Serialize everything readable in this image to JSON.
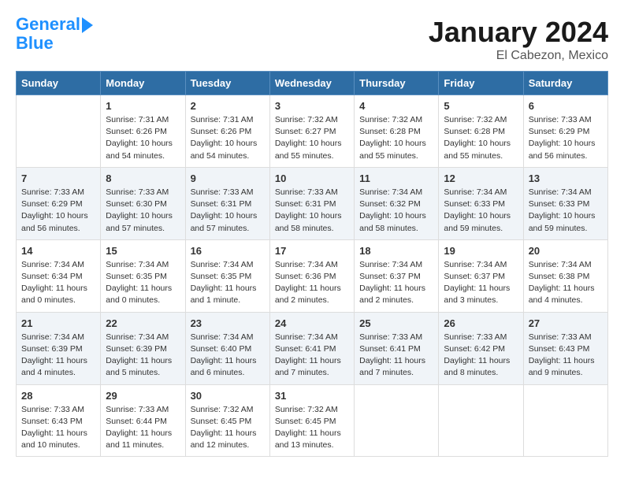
{
  "header": {
    "logo_line1": "General",
    "logo_line2": "Blue",
    "month": "January 2024",
    "location": "El Cabezon, Mexico"
  },
  "days_of_week": [
    "Sunday",
    "Monday",
    "Tuesday",
    "Wednesday",
    "Thursday",
    "Friday",
    "Saturday"
  ],
  "weeks": [
    [
      {
        "day": "",
        "info": ""
      },
      {
        "day": "1",
        "info": "Sunrise: 7:31 AM\nSunset: 6:26 PM\nDaylight: 10 hours\nand 54 minutes."
      },
      {
        "day": "2",
        "info": "Sunrise: 7:31 AM\nSunset: 6:26 PM\nDaylight: 10 hours\nand 54 minutes."
      },
      {
        "day": "3",
        "info": "Sunrise: 7:32 AM\nSunset: 6:27 PM\nDaylight: 10 hours\nand 55 minutes."
      },
      {
        "day": "4",
        "info": "Sunrise: 7:32 AM\nSunset: 6:28 PM\nDaylight: 10 hours\nand 55 minutes."
      },
      {
        "day": "5",
        "info": "Sunrise: 7:32 AM\nSunset: 6:28 PM\nDaylight: 10 hours\nand 55 minutes."
      },
      {
        "day": "6",
        "info": "Sunrise: 7:33 AM\nSunset: 6:29 PM\nDaylight: 10 hours\nand 56 minutes."
      }
    ],
    [
      {
        "day": "7",
        "info": "Sunrise: 7:33 AM\nSunset: 6:29 PM\nDaylight: 10 hours\nand 56 minutes."
      },
      {
        "day": "8",
        "info": "Sunrise: 7:33 AM\nSunset: 6:30 PM\nDaylight: 10 hours\nand 57 minutes."
      },
      {
        "day": "9",
        "info": "Sunrise: 7:33 AM\nSunset: 6:31 PM\nDaylight: 10 hours\nand 57 minutes."
      },
      {
        "day": "10",
        "info": "Sunrise: 7:33 AM\nSunset: 6:31 PM\nDaylight: 10 hours\nand 58 minutes."
      },
      {
        "day": "11",
        "info": "Sunrise: 7:34 AM\nSunset: 6:32 PM\nDaylight: 10 hours\nand 58 minutes."
      },
      {
        "day": "12",
        "info": "Sunrise: 7:34 AM\nSunset: 6:33 PM\nDaylight: 10 hours\nand 59 minutes."
      },
      {
        "day": "13",
        "info": "Sunrise: 7:34 AM\nSunset: 6:33 PM\nDaylight: 10 hours\nand 59 minutes."
      }
    ],
    [
      {
        "day": "14",
        "info": "Sunrise: 7:34 AM\nSunset: 6:34 PM\nDaylight: 11 hours\nand 0 minutes."
      },
      {
        "day": "15",
        "info": "Sunrise: 7:34 AM\nSunset: 6:35 PM\nDaylight: 11 hours\nand 0 minutes."
      },
      {
        "day": "16",
        "info": "Sunrise: 7:34 AM\nSunset: 6:35 PM\nDaylight: 11 hours\nand 1 minute."
      },
      {
        "day": "17",
        "info": "Sunrise: 7:34 AM\nSunset: 6:36 PM\nDaylight: 11 hours\nand 2 minutes."
      },
      {
        "day": "18",
        "info": "Sunrise: 7:34 AM\nSunset: 6:37 PM\nDaylight: 11 hours\nand 2 minutes."
      },
      {
        "day": "19",
        "info": "Sunrise: 7:34 AM\nSunset: 6:37 PM\nDaylight: 11 hours\nand 3 minutes."
      },
      {
        "day": "20",
        "info": "Sunrise: 7:34 AM\nSunset: 6:38 PM\nDaylight: 11 hours\nand 4 minutes."
      }
    ],
    [
      {
        "day": "21",
        "info": "Sunrise: 7:34 AM\nSunset: 6:39 PM\nDaylight: 11 hours\nand 4 minutes."
      },
      {
        "day": "22",
        "info": "Sunrise: 7:34 AM\nSunset: 6:39 PM\nDaylight: 11 hours\nand 5 minutes."
      },
      {
        "day": "23",
        "info": "Sunrise: 7:34 AM\nSunset: 6:40 PM\nDaylight: 11 hours\nand 6 minutes."
      },
      {
        "day": "24",
        "info": "Sunrise: 7:34 AM\nSunset: 6:41 PM\nDaylight: 11 hours\nand 7 minutes."
      },
      {
        "day": "25",
        "info": "Sunrise: 7:33 AM\nSunset: 6:41 PM\nDaylight: 11 hours\nand 7 minutes."
      },
      {
        "day": "26",
        "info": "Sunrise: 7:33 AM\nSunset: 6:42 PM\nDaylight: 11 hours\nand 8 minutes."
      },
      {
        "day": "27",
        "info": "Sunrise: 7:33 AM\nSunset: 6:43 PM\nDaylight: 11 hours\nand 9 minutes."
      }
    ],
    [
      {
        "day": "28",
        "info": "Sunrise: 7:33 AM\nSunset: 6:43 PM\nDaylight: 11 hours\nand 10 minutes."
      },
      {
        "day": "29",
        "info": "Sunrise: 7:33 AM\nSunset: 6:44 PM\nDaylight: 11 hours\nand 11 minutes."
      },
      {
        "day": "30",
        "info": "Sunrise: 7:32 AM\nSunset: 6:45 PM\nDaylight: 11 hours\nand 12 minutes."
      },
      {
        "day": "31",
        "info": "Sunrise: 7:32 AM\nSunset: 6:45 PM\nDaylight: 11 hours\nand 13 minutes."
      },
      {
        "day": "",
        "info": ""
      },
      {
        "day": "",
        "info": ""
      },
      {
        "day": "",
        "info": ""
      }
    ]
  ]
}
